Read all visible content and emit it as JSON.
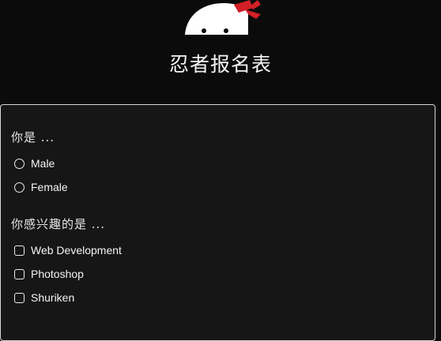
{
  "header": {
    "title": "忍者报名表",
    "logo_icon": "ninja-head-icon"
  },
  "form": {
    "gender": {
      "label": "你是 ...",
      "options": [
        "Male",
        "Female"
      ]
    },
    "interests": {
      "label": "你感兴趣的是 ...",
      "options": [
        "Web Development",
        "Photoshop",
        "Shuriken"
      ]
    }
  },
  "colors": {
    "background": "#0b0b0b",
    "card": "#161616",
    "card_border": "#d7d7d7",
    "headband": "#d31f26",
    "text": "#f2f2f2"
  }
}
